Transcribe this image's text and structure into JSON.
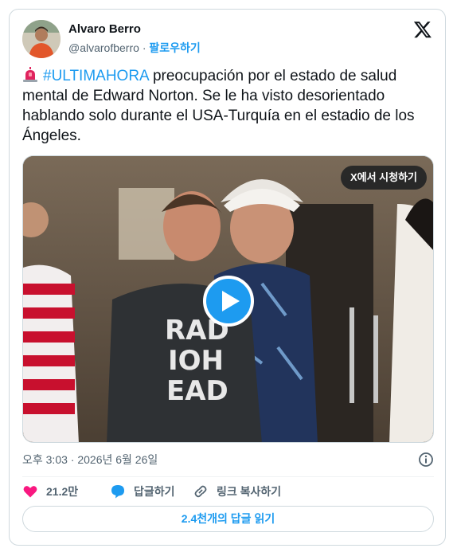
{
  "author": {
    "name": "Alvaro Berro",
    "handle": "@alvarofberro",
    "separator": "·",
    "follow_label": "팔로우하기"
  },
  "tweet": {
    "hashtag": "#ULTIMAHORA",
    "text": " preocupación por el estado de salud mental de Edward Norton. Se le ha visto desorientado hablando solo durante el USA-Turquía en el estadio de los Ángeles."
  },
  "media": {
    "watch_label": "X에서 시청하기",
    "shirt_text": [
      "RAD",
      "IOH",
      "EAD"
    ]
  },
  "meta": {
    "timestamp": "오후 3:03 · 2026년 6월 26일"
  },
  "actions": {
    "likes": "21.2만",
    "reply_label": "답글하기",
    "copy_link_label": "링크 복사하기"
  },
  "replies_button": "2.4천개의 답글 읽기",
  "colors": {
    "accent": "#1d9bf0",
    "like": "#f91880",
    "text_primary": "#0f1419",
    "text_secondary": "#536471"
  }
}
